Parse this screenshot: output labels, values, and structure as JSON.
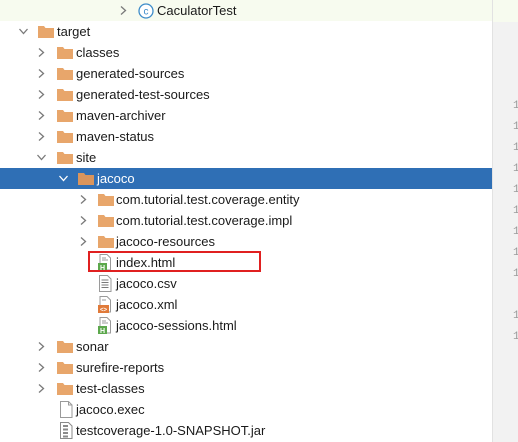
{
  "tree": {
    "class_item": "CaculatorTest",
    "target": "target",
    "classes": "classes",
    "generated_sources": "generated-sources",
    "generated_test_sources": "generated-test-sources",
    "maven_archiver": "maven-archiver",
    "maven_status": "maven-status",
    "site": "site",
    "jacoco": "jacoco",
    "pkg_entity": "com.tutorial.test.coverage.entity",
    "pkg_impl": "com.tutorial.test.coverage.impl",
    "jacoco_resources": "jacoco-resources",
    "index_html": "index.html",
    "jacoco_csv": "jacoco.csv",
    "jacoco_xml": "jacoco.xml",
    "jacoco_sessions_html": "jacoco-sessions.html",
    "sonar": "sonar",
    "surefire_reports": "surefire-reports",
    "test_classes": "test-classes",
    "jacoco_exec": "jacoco.exec",
    "jar": "testcoverage-1.0-SNAPSHOT.jar"
  },
  "gutter": [
    "1",
    "1",
    "1",
    "1",
    "1",
    "1",
    "1",
    "1",
    "1",
    "1",
    "1"
  ],
  "colors": {
    "selection": "#2f6fb5",
    "folder": "#e8a66b",
    "highlight": "#e02020",
    "class_badge": "#3e8cc9"
  },
  "icons": {
    "class": "class-c-icon",
    "folder": "folder-icon",
    "html": "html-file-icon",
    "csv": "text-file-icon",
    "xml": "xml-file-icon",
    "exec": "generic-file-icon",
    "jar": "jar-file-icon"
  }
}
